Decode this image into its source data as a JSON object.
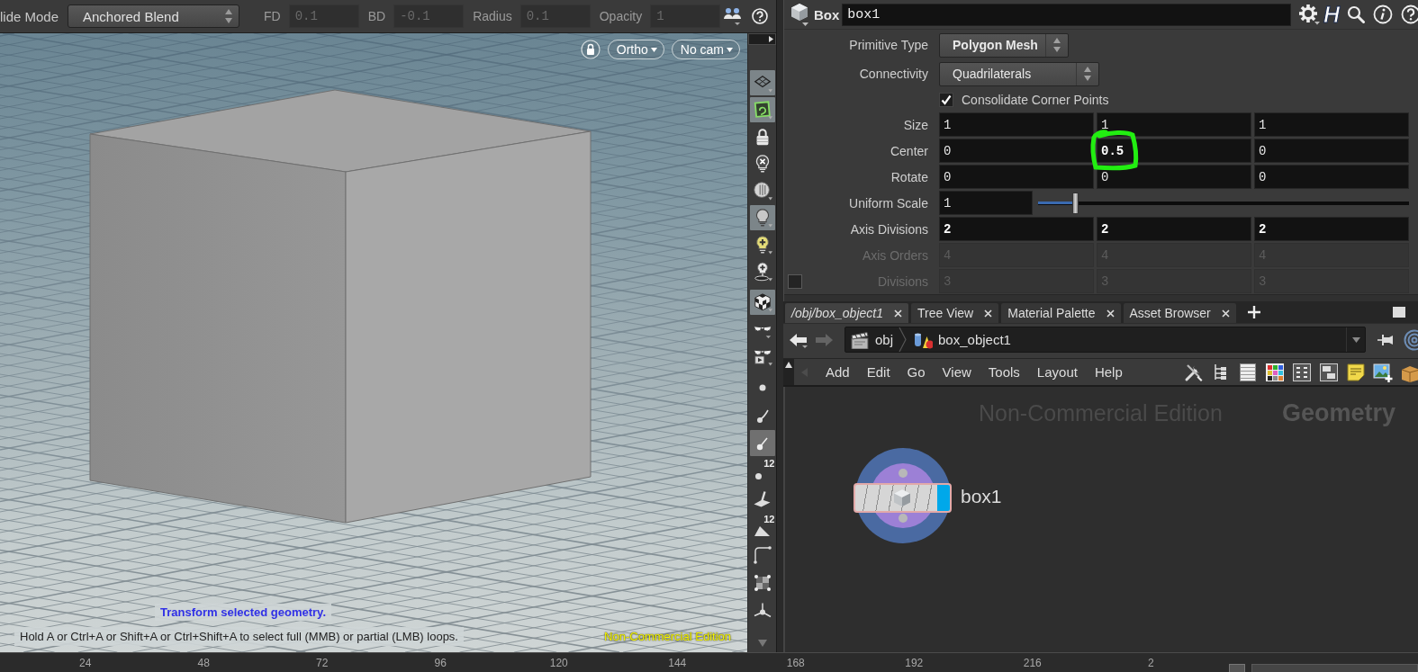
{
  "viewer_toolbar": {
    "mode_label": "lide Mode",
    "mode_dropdown": "Anchored Blend",
    "fields": [
      {
        "label": "FD",
        "value": "0.1",
        "disabled": true
      },
      {
        "label": "BD",
        "value": "-0.1",
        "disabled": true
      },
      {
        "label": "Radius",
        "value": "0.1",
        "disabled": true
      },
      {
        "label": "Opacity",
        "value": "1",
        "disabled": true
      }
    ]
  },
  "viewport": {
    "view_menus": [
      "Ortho",
      "No cam"
    ],
    "hint_title": "Transform selected geometry.",
    "hint": "Hold A or Ctrl+A or Shift+A or Ctrl+Shift+A to select full (MMB) or partial (LMB) loops.",
    "edition_label": "Non-Commercial Edition"
  },
  "shelf_groups": [
    [
      {
        "selected": true
      },
      {
        "selected": true
      },
      {
        "selected": false
      },
      {
        "selected": false
      },
      {
        "selected": false
      },
      {
        "selected": true
      },
      {
        "selected": false
      },
      {
        "selected": false
      }
    ],
    [
      {
        "selected": true
      },
      {
        "selected": false
      },
      {
        "selected": false
      }
    ],
    [
      {
        "selected": false
      },
      {
        "selected": false
      },
      {
        "selected": true
      },
      {
        "selected": false,
        "badge": "12"
      },
      {
        "selected": false
      },
      {
        "selected": false,
        "badge": "12"
      },
      {
        "selected": false
      },
      {
        "selected": false
      },
      {
        "selected": false
      }
    ]
  ],
  "parameters": {
    "node_type": "Box",
    "node_name": "box1",
    "menu_letter": "H",
    "rows": [
      {
        "kind": "dropdown",
        "label": "Primitive Type",
        "value": "Polygon Mesh",
        "modified": true,
        "disabled": false
      },
      {
        "kind": "dropdown",
        "label": "Connectivity",
        "value": "Quadrilaterals",
        "modified": false,
        "disabled": false
      },
      {
        "kind": "checkbox",
        "label": "Consolidate Corner Points",
        "checked": true,
        "disabled": false
      },
      {
        "kind": "vector",
        "label": "Size",
        "disabled": false,
        "values": [
          {
            "value": "1",
            "modified": false,
            "annotated": false
          },
          {
            "value": "1",
            "modified": false,
            "annotated": false
          },
          {
            "value": "1",
            "modified": false,
            "annotated": false
          }
        ]
      },
      {
        "kind": "vector",
        "label": "Center",
        "disabled": false,
        "values": [
          {
            "value": "0",
            "modified": false,
            "annotated": false
          },
          {
            "value": "0.5",
            "modified": true,
            "annotated": true
          },
          {
            "value": "0",
            "modified": false,
            "annotated": false
          }
        ]
      },
      {
        "kind": "vector",
        "label": "Rotate",
        "disabled": false,
        "values": [
          {
            "value": "0",
            "modified": false,
            "annotated": false
          },
          {
            "value": "0",
            "modified": false,
            "annotated": false
          },
          {
            "value": "0",
            "modified": false,
            "annotated": false
          }
        ]
      },
      {
        "kind": "slider",
        "label": "Uniform Scale",
        "disabled": false,
        "value": "1",
        "modified": false,
        "level": 0.1
      },
      {
        "kind": "vector",
        "label": "Axis Divisions",
        "disabled": false,
        "values": [
          {
            "value": "2",
            "modified": true,
            "annotated": false
          },
          {
            "value": "2",
            "modified": true,
            "annotated": false
          },
          {
            "value": "2",
            "modified": true,
            "annotated": false
          }
        ]
      },
      {
        "kind": "vector",
        "label": "Axis Orders",
        "disabled": true,
        "values": [
          {
            "value": "4",
            "modified": false,
            "annotated": false
          },
          {
            "value": "4",
            "modified": false,
            "annotated": false
          },
          {
            "value": "4",
            "modified": false,
            "annotated": false
          }
        ]
      },
      {
        "kind": "vector",
        "label": "Divisions",
        "disabled": true,
        "toggle": {
          "checked": false
        },
        "values": [
          {
            "value": "3",
            "modified": false,
            "annotated": false
          },
          {
            "value": "3",
            "modified": false,
            "annotated": false
          },
          {
            "value": "3",
            "modified": false,
            "annotated": false
          }
        ]
      }
    ]
  },
  "network": {
    "tabs": [
      {
        "label": "/obj/box_object1",
        "kind": "network",
        "selected": true
      },
      {
        "label": "Tree View",
        "kind": "pane",
        "selected": false
      },
      {
        "label": "Material Palette",
        "kind": "pane",
        "selected": false
      },
      {
        "label": "Asset Browser",
        "kind": "pane",
        "selected": false
      }
    ],
    "nav_buttons": [
      {
        "disabled": false
      },
      {
        "disabled": true
      }
    ],
    "path": [
      "obj",
      "box_object1"
    ],
    "menu": [
      "Add",
      "Edit",
      "Go",
      "View",
      "Tools",
      "Layout",
      "Help"
    ],
    "edition_label": "Non-Commercial Edition",
    "context_label": "Geometry",
    "node": {
      "name": "box1",
      "display": true
    }
  },
  "timeline": {
    "ticks": [
      "24",
      "48",
      "72",
      "96",
      "120",
      "144",
      "168",
      "192",
      "216",
      "2"
    ]
  }
}
